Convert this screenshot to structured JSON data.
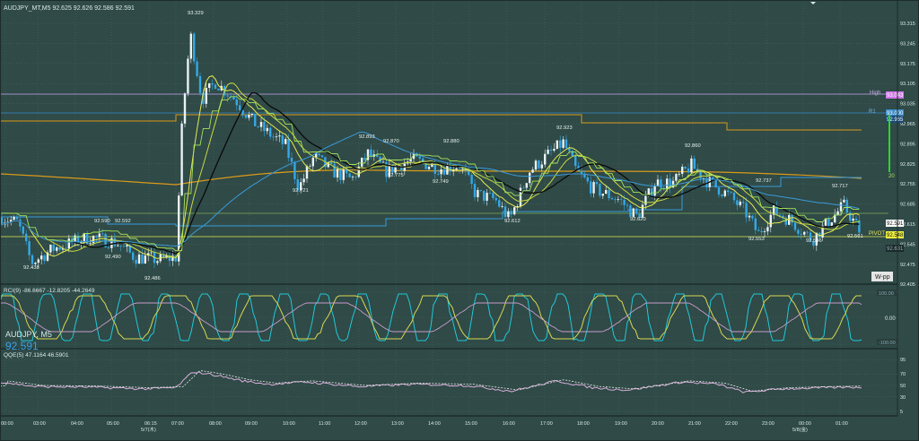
{
  "window": {
    "header": "AUDJPY_MT,M5  92.625 92.626 92.586 92.591"
  },
  "colors": {
    "background": "#2f4a47",
    "grid": "#4f6a66",
    "candle": "#35a8e6",
    "black_ma": "#0a0a0a",
    "yellow_ma": "#e6ea52",
    "green_line": "#a6e35a",
    "orange_line": "#d99a1a",
    "blue_ma": "#3a9ad9",
    "lavender_line": "#c8a8e8",
    "wpp_badge": "#e5e5e5"
  },
  "main_panel": {
    "price_labels": [
      "93.315",
      "93.245",
      "93.175",
      "93.105",
      "93.035",
      "92.965",
      "92.895",
      "92.825",
      "92.755",
      "92.685",
      "92.615",
      "92.545",
      "92.475",
      "92.405"
    ],
    "current_price_label": "92.591",
    "level_labels": {
      "high_label": "High",
      "high_value": "93.043",
      "r1_label": "R1",
      "r1_value": "93.000",
      "pivot_label": "PIVOT",
      "pivot_value": "92.548",
      "l2_value": "92.631"
    },
    "marker_20": "20",
    "marker_20b": "20",
    "wpp_badge": "W-pp",
    "annotations": [
      {
        "text": "93.329"
      },
      {
        "text": "92.438"
      },
      {
        "text": "92.590"
      },
      {
        "text": "92.592"
      },
      {
        "text": "92.490"
      },
      {
        "text": "92.486"
      },
      {
        "text": "92.721"
      },
      {
        "text": "92.893"
      },
      {
        "text": "92.870"
      },
      {
        "text": "92.880"
      },
      {
        "text": "92.775"
      },
      {
        "text": "92.749"
      },
      {
        "text": "92.923"
      },
      {
        "text": "92.612"
      },
      {
        "text": "92.860"
      },
      {
        "text": "92.620"
      },
      {
        "text": "92.737"
      },
      {
        "text": "92.717"
      },
      {
        "text": "92.553"
      },
      {
        "text": "92.546"
      },
      {
        "text": "92.561"
      }
    ]
  },
  "rci_panel": {
    "header": "RCI(9) -86.6667 -12.8205 -44.2649",
    "symbol_label": "AUDJPY, M5",
    "price_overlay": "92.591",
    "scale_labels": [
      "0.00"
    ],
    "top_badge": "100.00",
    "bottom_badge": "-100.00"
  },
  "second_panel": {
    "header": "QQE(5) 47.1164 46.5901",
    "scale_labels": [
      "95",
      "70",
      "50",
      "30",
      "5"
    ]
  },
  "time_axis": {
    "labels": [
      "00:00",
      "03:00",
      "04:00",
      "05:00",
      "06:15",
      "07:00",
      "08:00",
      "09:00",
      "10:00",
      "11:00",
      "12:00",
      "13:00",
      "14:00",
      "15:00",
      "16:00",
      "17:00",
      "18:00",
      "19:00",
      "20:00",
      "21:00",
      "22:00",
      "23:00",
      "00:00",
      "01:00"
    ],
    "date_label_1": "5/7(木)",
    "date_label_2": "5/8(金)"
  }
}
